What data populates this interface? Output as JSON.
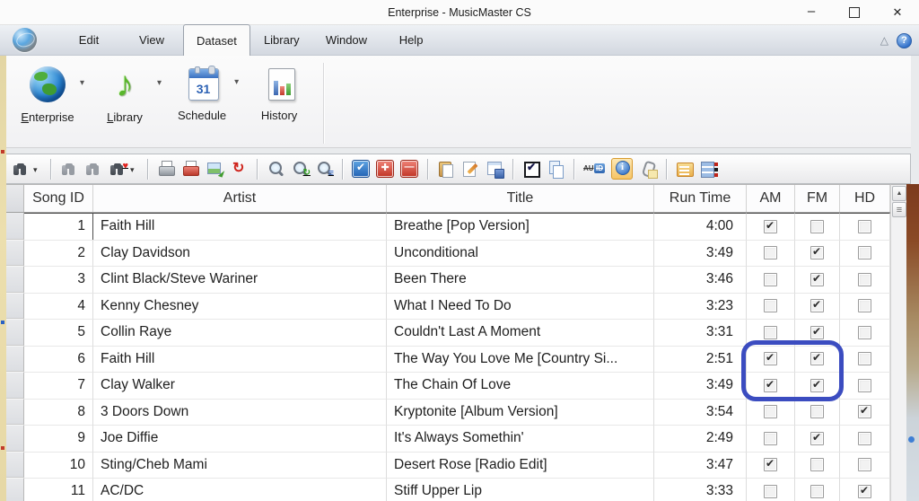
{
  "window": {
    "title": "Enterprise - MusicMaster CS"
  },
  "menu": {
    "tabs": [
      {
        "label": "Edit",
        "active": false
      },
      {
        "label": "View",
        "active": false
      },
      {
        "label": "Dataset",
        "active": true
      },
      {
        "label": "Library",
        "active": false
      },
      {
        "label": "Window",
        "active": false
      },
      {
        "label": "Help",
        "active": false
      }
    ],
    "right_icons": [
      "collapse-ribbon",
      "help"
    ]
  },
  "ribbon": {
    "buttons": [
      {
        "label": "Enterprise",
        "icon": "globe",
        "dropdown": true,
        "underline_first": true
      },
      {
        "label": "Library",
        "icon": "note",
        "dropdown": true,
        "underline_first": true
      },
      {
        "label": "Schedule",
        "icon": "calendar",
        "dropdown": true,
        "underline_first": false,
        "calendar_day": "31"
      },
      {
        "label": "History",
        "icon": "chart-doc",
        "dropdown": false,
        "underline_first": false
      }
    ]
  },
  "toolbar": {
    "items": [
      {
        "name": "find",
        "dropdown": true
      },
      {
        "sep": true
      },
      {
        "name": "find-next"
      },
      {
        "name": "find-previous"
      },
      {
        "name": "find-favorite",
        "overlay": "heart",
        "dropdown": true
      },
      {
        "sep": true
      },
      {
        "name": "print-preview"
      },
      {
        "name": "print"
      },
      {
        "name": "export"
      },
      {
        "name": "refresh"
      },
      {
        "sep": true
      },
      {
        "name": "zoom"
      },
      {
        "name": "zoom-refresh",
        "overlay": "refresh-green"
      },
      {
        "name": "zoom-list",
        "overlay": "list-blue"
      },
      {
        "sep": true
      },
      {
        "name": "mark-blue"
      },
      {
        "name": "add"
      },
      {
        "name": "delete"
      },
      {
        "sep": true
      },
      {
        "name": "paste"
      },
      {
        "name": "edit"
      },
      {
        "name": "save-grid"
      },
      {
        "sep": true
      },
      {
        "name": "select-check"
      },
      {
        "name": "copy"
      },
      {
        "sep": true
      },
      {
        "name": "auto-id",
        "au": "AU",
        "id": "ID"
      },
      {
        "name": "song-info",
        "active": true
      },
      {
        "name": "attachments"
      },
      {
        "sep": true
      },
      {
        "name": "categories"
      },
      {
        "name": "fields"
      }
    ]
  },
  "table": {
    "headers": [
      {
        "key": "song_id",
        "label": "Song ID"
      },
      {
        "key": "artist",
        "label": "Artist"
      },
      {
        "key": "title",
        "label": "Title"
      },
      {
        "key": "run_time",
        "label": "Run Time"
      },
      {
        "key": "am",
        "label": "AM"
      },
      {
        "key": "fm",
        "label": "FM"
      },
      {
        "key": "hd",
        "label": "HD"
      }
    ],
    "rows": [
      {
        "song_id": "1",
        "artist": "Faith Hill",
        "title": "Breathe [Pop Version]",
        "run_time": "4:00",
        "am": true,
        "fm": false,
        "hd": false
      },
      {
        "song_id": "2",
        "artist": "Clay Davidson",
        "title": "Unconditional",
        "run_time": "3:49",
        "am": false,
        "fm": true,
        "hd": false
      },
      {
        "song_id": "3",
        "artist": "Clint Black/Steve Wariner",
        "title": "Been There",
        "run_time": "3:46",
        "am": false,
        "fm": true,
        "hd": false
      },
      {
        "song_id": "4",
        "artist": "Kenny Chesney",
        "title": "What I Need To Do",
        "run_time": "3:23",
        "am": false,
        "fm": true,
        "hd": false
      },
      {
        "song_id": "5",
        "artist": "Collin Raye",
        "title": "Couldn't Last A Moment",
        "run_time": "3:31",
        "am": false,
        "fm": true,
        "hd": false
      },
      {
        "song_id": "6",
        "artist": "Faith Hill",
        "title": "The Way You Love Me [Country Si...",
        "run_time": "2:51",
        "am": true,
        "fm": true,
        "hd": false
      },
      {
        "song_id": "7",
        "artist": "Clay Walker",
        "title": "The Chain Of Love",
        "run_time": "3:49",
        "am": true,
        "fm": true,
        "hd": false
      },
      {
        "song_id": "8",
        "artist": "3 Doors Down",
        "title": "Kryptonite [Album Version]",
        "run_time": "3:54",
        "am": false,
        "fm": false,
        "hd": true
      },
      {
        "song_id": "9",
        "artist": "Joe Diffie",
        "title": "It's Always Somethin'",
        "run_time": "2:49",
        "am": false,
        "fm": true,
        "hd": false
      },
      {
        "song_id": "10",
        "artist": "Sting/Cheb Mami",
        "title": "Desert Rose [Radio Edit]",
        "run_time": "3:47",
        "am": true,
        "fm": false,
        "hd": false
      },
      {
        "song_id": "11",
        "artist": "AC/DC",
        "title": "Stiff Upper Lip",
        "run_time": "3:33",
        "am": false,
        "fm": false,
        "hd": true
      }
    ]
  },
  "annotation": {
    "color": "#3b4cc0"
  }
}
